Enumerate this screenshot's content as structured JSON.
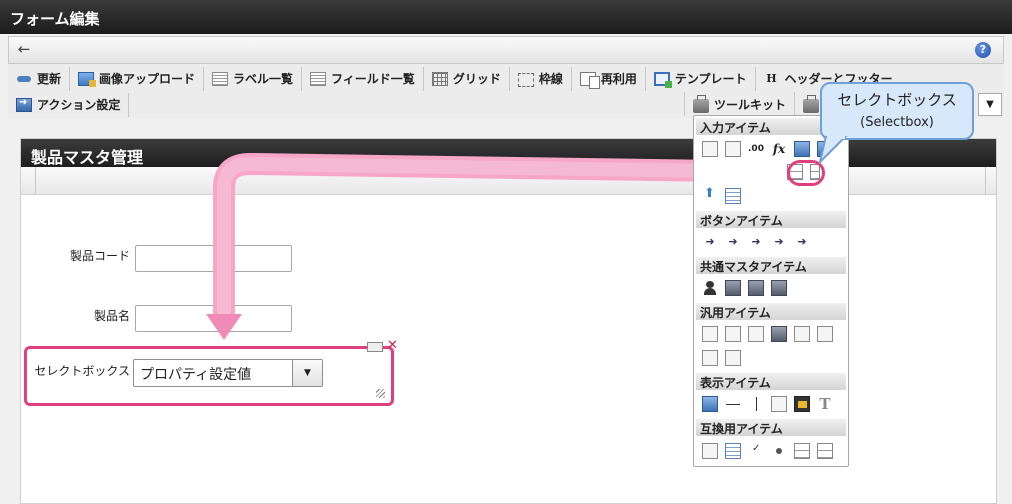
{
  "window": {
    "title": "フォーム編集"
  },
  "nav": {
    "back_icon": "back-arrow-icon",
    "help_label": "?"
  },
  "toolbar": {
    "row1": [
      {
        "label": "更新",
        "icon": "refresh-icon"
      },
      {
        "label": "画像アップロード",
        "icon": "image-upload-icon"
      },
      {
        "label": "ラベル一覧",
        "icon": "label-list-icon"
      },
      {
        "label": "フィールド一覧",
        "icon": "field-list-icon"
      },
      {
        "label": "グリッド",
        "icon": "grid-icon"
      },
      {
        "label": "枠線",
        "icon": "border-icon"
      },
      {
        "label": "再利用",
        "icon": "reuse-icon"
      },
      {
        "label": "テンプレート",
        "icon": "template-icon"
      },
      {
        "label": "ヘッダーとフッター",
        "icon": "header-footer-icon"
      }
    ],
    "row2": [
      {
        "label": "アクション設定",
        "icon": "action-icon"
      }
    ],
    "toolkit_button": "ツールキット",
    "dropdown_arrow": "▼"
  },
  "form": {
    "title": "製品マスタ管理",
    "fields": [
      {
        "label": "製品コード"
      },
      {
        "label": "製品名"
      },
      {
        "label": "セレクトボックス",
        "value": "プロパティ設定値"
      }
    ]
  },
  "toolkit": {
    "sections": [
      "入力アイテム",
      "ボタンアイテム",
      "共通マスタアイテム",
      "汎用アイテム",
      "表示アイテム",
      "互換用アイテム"
    ],
    "fx_label": "fx",
    "num_label": ".00"
  },
  "callout": {
    "line1": "セレクトボックス",
    "line2": "(Selectbox)",
    "colors": {
      "border": "#6f9fd7",
      "fill": "#d8e8fb"
    }
  },
  "accent_color": "#e0407d"
}
